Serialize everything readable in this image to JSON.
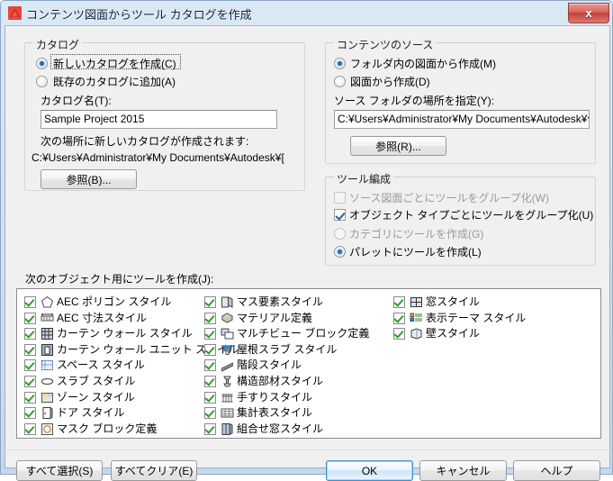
{
  "window": {
    "title": "コンテンツ図面からツール カタログを作成",
    "app_icon": "autocad-red-triangle-icon",
    "close_label": "x"
  },
  "catalog_group": {
    "title": "カタログ",
    "radio_new": "新しいカタログを作成(C)",
    "radio_add_existing": "既存のカタログに追加(A)",
    "name_label": "カタログ名(T):",
    "name_value": "Sample Project 2015",
    "name_placeholder": "",
    "location_note": "次の場所に新しいカタログが作成されます:",
    "location_path": "C:¥Users¥Administrator¥My Documents¥Autodesk¥[",
    "browse_label": "参照(B)..."
  },
  "content_source_group": {
    "title": "コンテンツのソース",
    "radio_folder": "フォルダ内の図面から作成(M)",
    "radio_drawing": "図面から作成(D)",
    "source_label": "ソース フォルダの場所を指定(Y):",
    "source_value": "C:¥Users¥Administrator¥My Documents¥Autodesk¥個,",
    "source_placeholder": "",
    "browse_label": "参照(R)..."
  },
  "tool_org_group": {
    "title": "ツール編成",
    "cb_group_by_source": "ソース図面ごとにツールをグループ化(W)",
    "cb_group_by_type": "オブジェクト タイプごとにツールをグループ化(U)",
    "radio_category": "カテゴリにツールを作成(G)",
    "radio_palette": "パレットにツールを作成(L)"
  },
  "object_list": {
    "label": "次のオブジェクト用にツールを作成(J):",
    "columns": [
      [
        {
          "label": "AEC ポリゴン スタイル",
          "icon": "aec-polygon-icon",
          "checked": true
        },
        {
          "label": "AEC 寸法スタイル",
          "icon": "aec-dimension-icon",
          "checked": true
        },
        {
          "label": "カーテン ウォール スタイル",
          "icon": "curtain-wall-icon",
          "checked": true
        },
        {
          "label": "カーテン ウォール ユニット スタイル",
          "icon": "curtain-wall-unit-icon",
          "checked": true
        },
        {
          "label": "スペース スタイル",
          "icon": "space-style-icon",
          "checked": true
        },
        {
          "label": "スラブ スタイル",
          "icon": "slab-style-icon",
          "checked": true
        },
        {
          "label": "ゾーン スタイル",
          "icon": "zone-style-icon",
          "checked": true
        },
        {
          "label": "ドア スタイル",
          "icon": "door-style-icon",
          "checked": true
        },
        {
          "label": "マスク ブロック定義",
          "icon": "mask-block-icon",
          "checked": true
        }
      ],
      [
        {
          "label": "マス要素スタイル",
          "icon": "mass-element-icon",
          "checked": true
        },
        {
          "label": "マテリアル定義",
          "icon": "material-definition-icon",
          "checked": true
        },
        {
          "label": "マルチビュー ブロック定義",
          "icon": "multiview-block-icon",
          "checked": true
        },
        {
          "label": "屋根スラブ スタイル",
          "icon": "roof-slab-icon",
          "checked": true
        },
        {
          "label": "階段スタイル",
          "icon": "stair-style-icon",
          "checked": true
        },
        {
          "label": "構造部材スタイル",
          "icon": "structural-member-icon",
          "checked": true
        },
        {
          "label": "手すりスタイル",
          "icon": "railing-style-icon",
          "checked": true
        },
        {
          "label": "集計表スタイル",
          "icon": "schedule-table-icon",
          "checked": true
        },
        {
          "label": "組合せ窓スタイル",
          "icon": "window-assembly-icon",
          "checked": true
        }
      ],
      [
        {
          "label": "窓スタイル",
          "icon": "window-style-icon",
          "checked": true
        },
        {
          "label": "表示テーマ スタイル",
          "icon": "display-theme-icon",
          "checked": true
        },
        {
          "label": "壁スタイル",
          "icon": "wall-style-icon",
          "checked": true
        }
      ]
    ]
  },
  "footer": {
    "select_all": "すべて選択(S)",
    "clear_all": "すべてクリア(E)",
    "ok": "OK",
    "cancel": "キャンセル",
    "help": "ヘルプ"
  },
  "colors": {
    "accent": "#1c6fc4",
    "check_green": "#2f9e2f",
    "titlebar_from": "#dbe8f5",
    "titlebar_to": "#c6d9ec",
    "close_red": "#c34038",
    "dialog_bg": "#f0f0f0"
  }
}
